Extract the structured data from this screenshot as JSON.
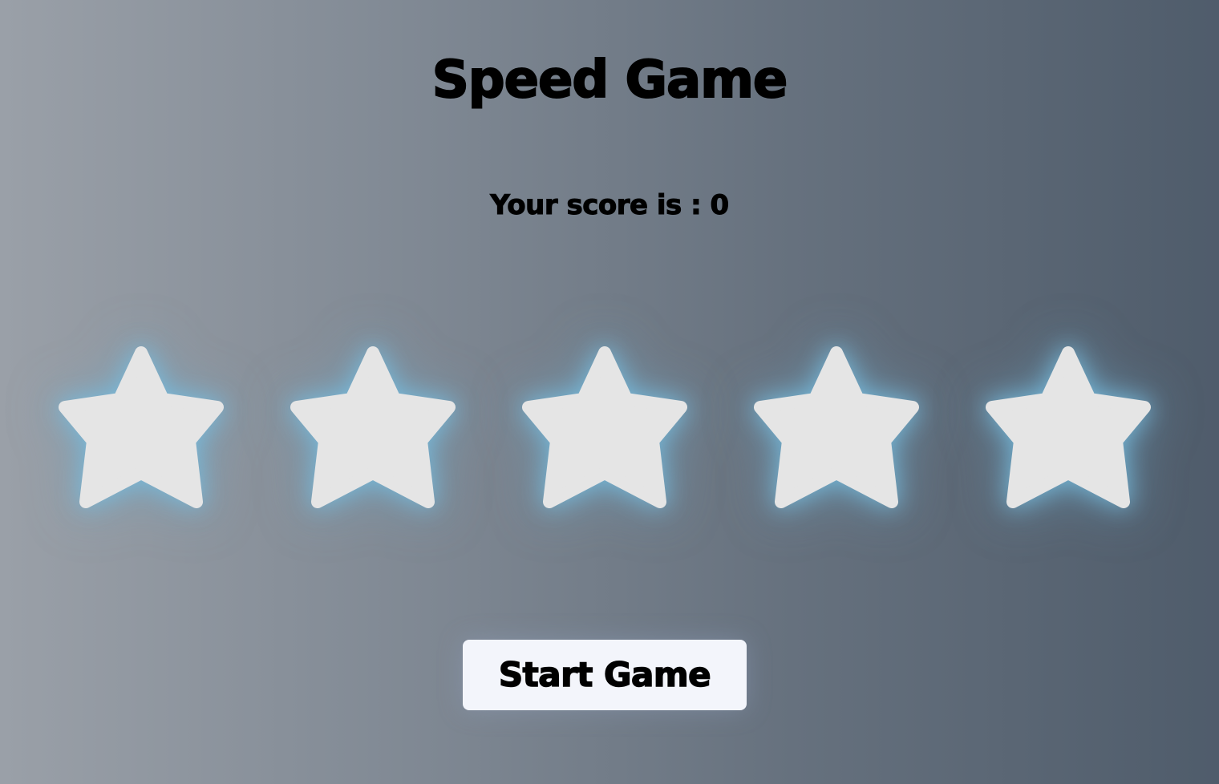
{
  "game": {
    "title": "Speed Game",
    "score_text": "Your score is : 0",
    "score": 0,
    "start_button_label": "Start Game"
  },
  "stars": {
    "count": 5,
    "icon": "star-icon",
    "fill_color": "#e5e5e5",
    "glow_color": "#78bee1"
  },
  "colors": {
    "background_start": "#9aa0a8",
    "background_end": "#4f5c6b",
    "button_background": "#f3f5fb",
    "text": "#000000"
  }
}
